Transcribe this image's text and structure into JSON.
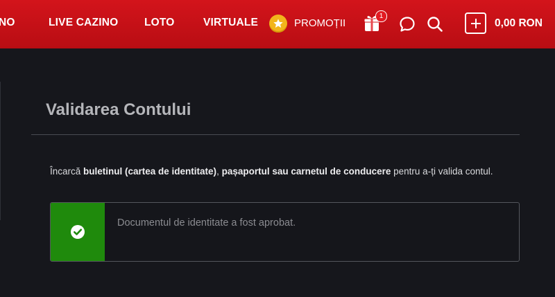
{
  "nav": {
    "items": [
      "NO",
      "LIVE CAZINO",
      "LOTO",
      "VIRTUALE"
    ],
    "promo_label": "PROMOȚII",
    "promo_icon": "star-icon",
    "gift_icon": "gift-icon",
    "gift_badge": "1",
    "chat_icon": "chat-bubble-icon",
    "search_icon": "search-icon",
    "deposit_icon": "plus-icon",
    "balance": "0,00 RON"
  },
  "colors": {
    "nav_background": "#c8121a",
    "page_background": "#16171c",
    "success_green": "#1f8a0c",
    "promo_gold": "#f2b51c"
  },
  "page": {
    "title": "Validarea Contului",
    "instructions": {
      "prefix": "Încarcă ",
      "doc_id": "buletinul (cartea de identitate)",
      "sep": ", ",
      "doc_other": "pașaportul sau carnetul de conducere",
      "suffix": " pentru a-ți valida contul."
    },
    "status": {
      "icon": "check-circle-icon",
      "message": "Documentul de identitate a fost aprobat."
    }
  }
}
